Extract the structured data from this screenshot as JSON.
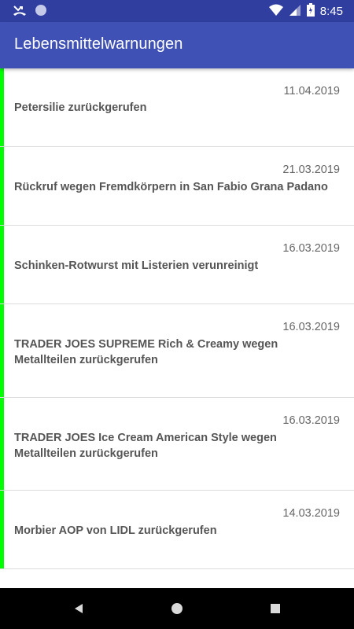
{
  "status_bar": {
    "time": "8:45",
    "icons": [
      "missed-call-icon",
      "circle-notification-icon",
      "wifi-icon",
      "signal-icon",
      "battery-icon"
    ]
  },
  "app_bar": {
    "title": "Lebensmittelwarnungen",
    "color": "#3f51b5"
  },
  "warnings": [
    {
      "date": "11.04.2019",
      "title": "Petersilie zurückgerufen",
      "accent_color": "#00ff00"
    },
    {
      "date": "21.03.2019",
      "title": "Rückruf wegen Fremdkörpern in San Fabio Grana Padano",
      "accent_color": "#00ff00"
    },
    {
      "date": "16.03.2019",
      "title": "Schinken-Rotwurst mit Listerien verunreinigt",
      "accent_color": "#00ff00"
    },
    {
      "date": "16.03.2019",
      "title": "TRADER JOES SUPREME Rich & Creamy wegen Metallteilen zurückgerufen",
      "accent_color": "#00ff00"
    },
    {
      "date": "16.03.2019",
      "title": "TRADER JOES Ice Cream American Style wegen Metallteilen zurückgerufen",
      "accent_color": "#00ff00"
    },
    {
      "date": "14.03.2019",
      "title": "Morbier AOP von LIDL zurückgerufen",
      "accent_color": "#00ff00"
    }
  ],
  "nav_bar": {
    "buttons": [
      "back-icon",
      "home-icon",
      "recents-icon"
    ]
  }
}
